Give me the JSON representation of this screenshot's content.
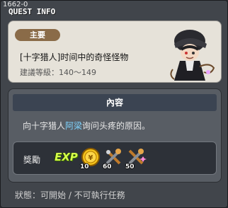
{
  "window": {
    "id_label": "1662-0",
    "title": "QUEST INFO"
  },
  "quest": {
    "tag": "主要",
    "name": "[十字猎人]时间中的奇怪怪物",
    "level": "建議等級：140～149"
  },
  "content": {
    "header": "內容",
    "text_before": "向十字猎人",
    "npc_name": "阿梁",
    "text_after": "询问头疼的原因。"
  },
  "reward": {
    "label": "獎勵",
    "exp_label": "EXP",
    "items": [
      {
        "icon": "gold-coin-icon",
        "qty": "10"
      },
      {
        "icon": "crossed-tools-icon",
        "qty": "60"
      },
      {
        "icon": "crossed-tools-sparkle-icon",
        "qty": "50"
      }
    ]
  },
  "status": "狀態：可開始 / 不可執行任務",
  "colors": {
    "window_bg": "#41454b",
    "info_card_bg": "#e6e2d9",
    "tag_bg": "#8a6b48",
    "content_bg": "#585d64",
    "header_bg": "#3b4452",
    "npc_link": "#7fd4ff"
  }
}
